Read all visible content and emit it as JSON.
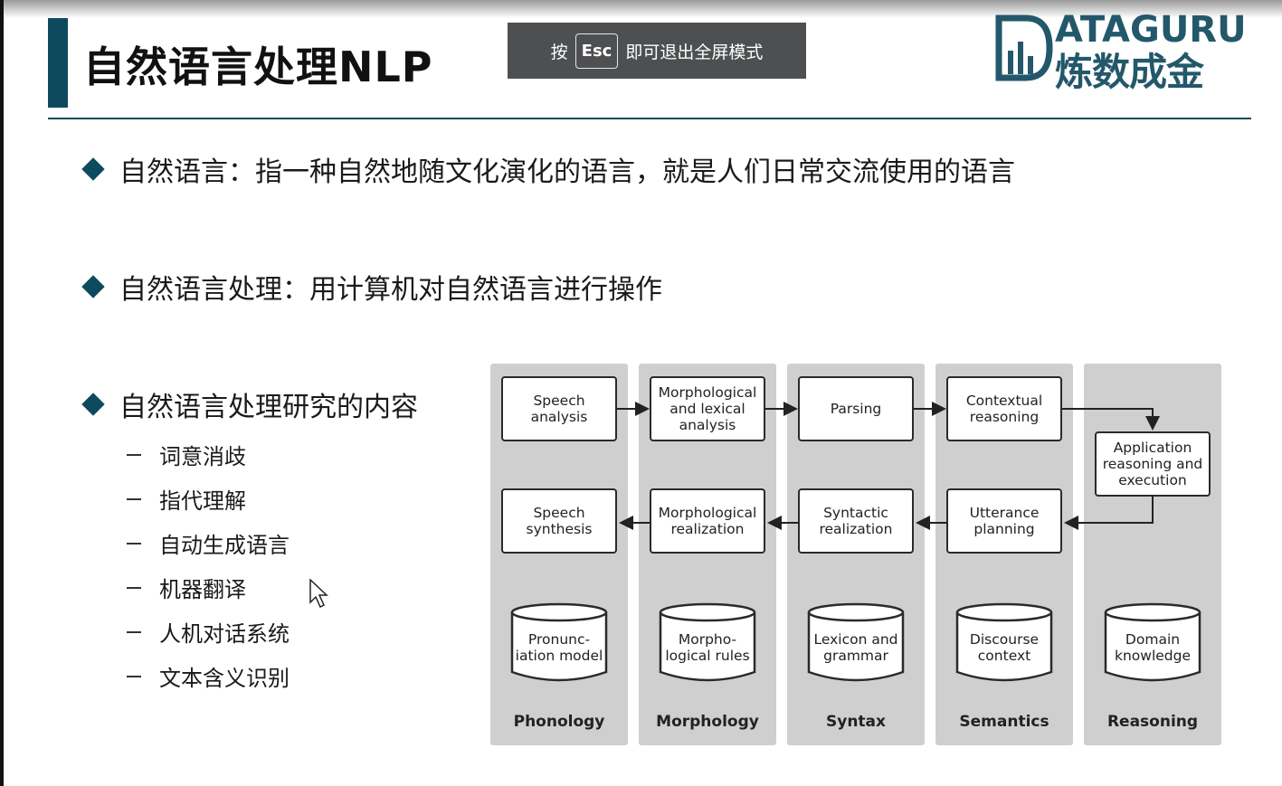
{
  "header": {
    "title": "自然语言处理NLP",
    "logo_en": "ATAGURU",
    "logo_cn": "炼数成金"
  },
  "esc_banner": {
    "prefix": "按",
    "key": "Esc",
    "suffix": "即可退出全屏模式"
  },
  "bullets": [
    "自然语言：指一种自然地随文化演化的语言，就是人们日常交流使用的语言",
    "自然语言处理：用计算机对自然语言进行操作",
    "自然语言处理研究的内容"
  ],
  "sub_items": [
    "词意消歧",
    "指代理解",
    "自动生成语言",
    "机器翻译",
    "人机对话系统",
    "文本含义识别"
  ],
  "diagram": {
    "columns": [
      "Phonology",
      "Morphology",
      "Syntax",
      "Semantics",
      "Reasoning"
    ],
    "top_row": [
      "Speech analysis",
      "Morphological and lexical analysis",
      "Parsing",
      "Contextual reasoning"
    ],
    "reasoning_box": "Application reasoning and execution",
    "bottom_row": [
      "Speech synthesis",
      "Morphological realization",
      "Syntactic realization",
      "Utterance planning"
    ],
    "knowledge": [
      "Pronunc-iation model",
      "Morpho-logical rules",
      "Lexicon and grammar",
      "Discourse context",
      "Domain knowledge"
    ]
  },
  "colors": {
    "accent": "#0e4a5e",
    "logo": "#23586b",
    "banner_bg": "#4d4f51",
    "column_bg": "#cfcfcf"
  },
  "icons": [
    "diamond-bullet-icon",
    "mouse-pointer-icon",
    "ataguru-logo-icon"
  ]
}
